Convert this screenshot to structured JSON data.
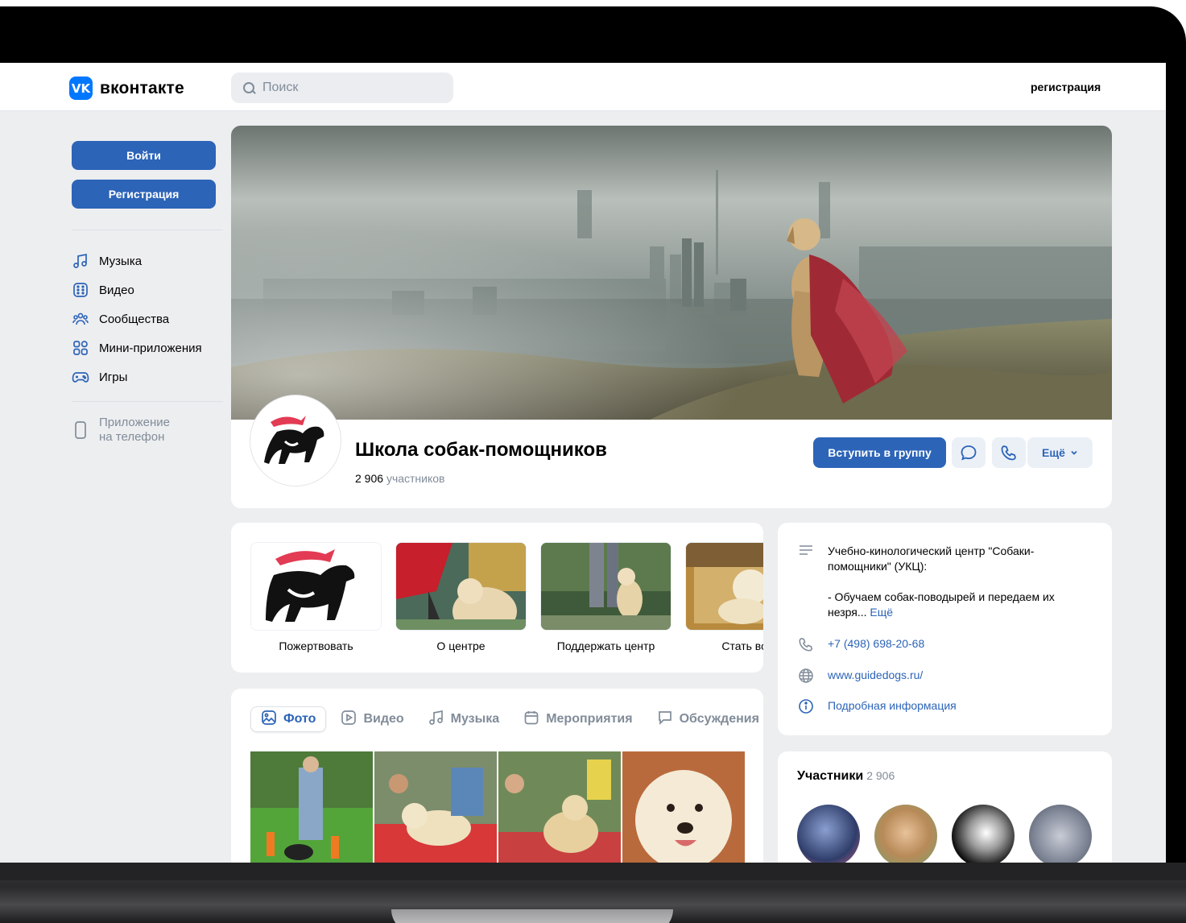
{
  "header": {
    "logo_letter": "VK",
    "logo_text": "вконтакте",
    "search_placeholder": "Поиск",
    "register_link": "регистрация"
  },
  "sidebar": {
    "login_button": "Войти",
    "register_button": "Регистрация",
    "items": [
      {
        "label": "Музыка",
        "icon": "music-icon"
      },
      {
        "label": "Видео",
        "icon": "video-icon"
      },
      {
        "label": "Сообщества",
        "icon": "communities-icon"
      },
      {
        "label": "Мини-приложения",
        "icon": "mini-apps-icon"
      },
      {
        "label": "Игры",
        "icon": "games-icon"
      }
    ],
    "phone_app_line1": "Приложение",
    "phone_app_line2": "на телефон"
  },
  "group": {
    "name": "Школа собак-помощников",
    "members_count": "2 906",
    "members_label": "участников",
    "join_button": "Вступить в группу",
    "more_button": "Ещё"
  },
  "links": [
    {
      "label": "Пожертвовать"
    },
    {
      "label": "О центре"
    },
    {
      "label": "Поддержать центр"
    },
    {
      "label": "Стать воло"
    }
  ],
  "tabs": [
    {
      "label": "Фото",
      "icon": "photo-icon"
    },
    {
      "label": "Видео",
      "icon": "video-icon"
    },
    {
      "label": "Музыка",
      "icon": "music-icon"
    },
    {
      "label": "Мероприятия",
      "icon": "calendar-icon"
    },
    {
      "label": "Обсуждения",
      "icon": "chat-icon"
    }
  ],
  "info": {
    "description_1": "Учебно-кинологический центр \"Собаки-помощники\" (УКЦ):",
    "description_2": "- Обучаем собак-поводырей и передаем их незря...",
    "more_link": "Ещё",
    "phone": "+7 (498) 698-20-68",
    "website": "www.guidedogs.ru/",
    "details_link": "Подробная информация"
  },
  "members": {
    "title": "Участники",
    "count": "2 906"
  },
  "colors": {
    "accent": "#2c64b8",
    "brand": "#0077ff",
    "page_bg": "#edeef0",
    "muted": "#818c99"
  }
}
